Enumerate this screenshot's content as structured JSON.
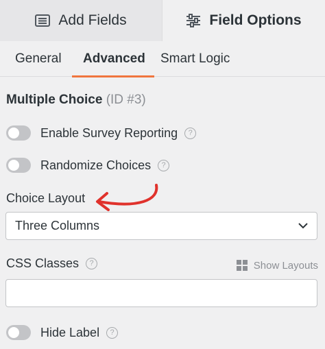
{
  "top_tabs": [
    {
      "label": "Add Fields",
      "icon": "list-icon"
    },
    {
      "label": "Field Options",
      "icon": "sliders-icon"
    }
  ],
  "sub_tabs": [
    "General",
    "Advanced",
    "Smart Logic"
  ],
  "active_sub_tab": "Advanced",
  "section": {
    "title": "Multiple Choice",
    "id_label": "(ID #3)"
  },
  "toggles": {
    "survey": {
      "label": "Enable Survey Reporting",
      "on": false
    },
    "randomize": {
      "label": "Randomize Choices",
      "on": false
    },
    "hide_label": {
      "label": "Hide Label",
      "on": false
    }
  },
  "choice_layout": {
    "label": "Choice Layout",
    "value": "Three Columns"
  },
  "css_classes": {
    "label": "CSS Classes",
    "show_layouts": "Show Layouts",
    "value": ""
  },
  "help_glyph": "?",
  "colors": {
    "accent": "#f0753e",
    "annotation_arrow": "#e0322c"
  }
}
